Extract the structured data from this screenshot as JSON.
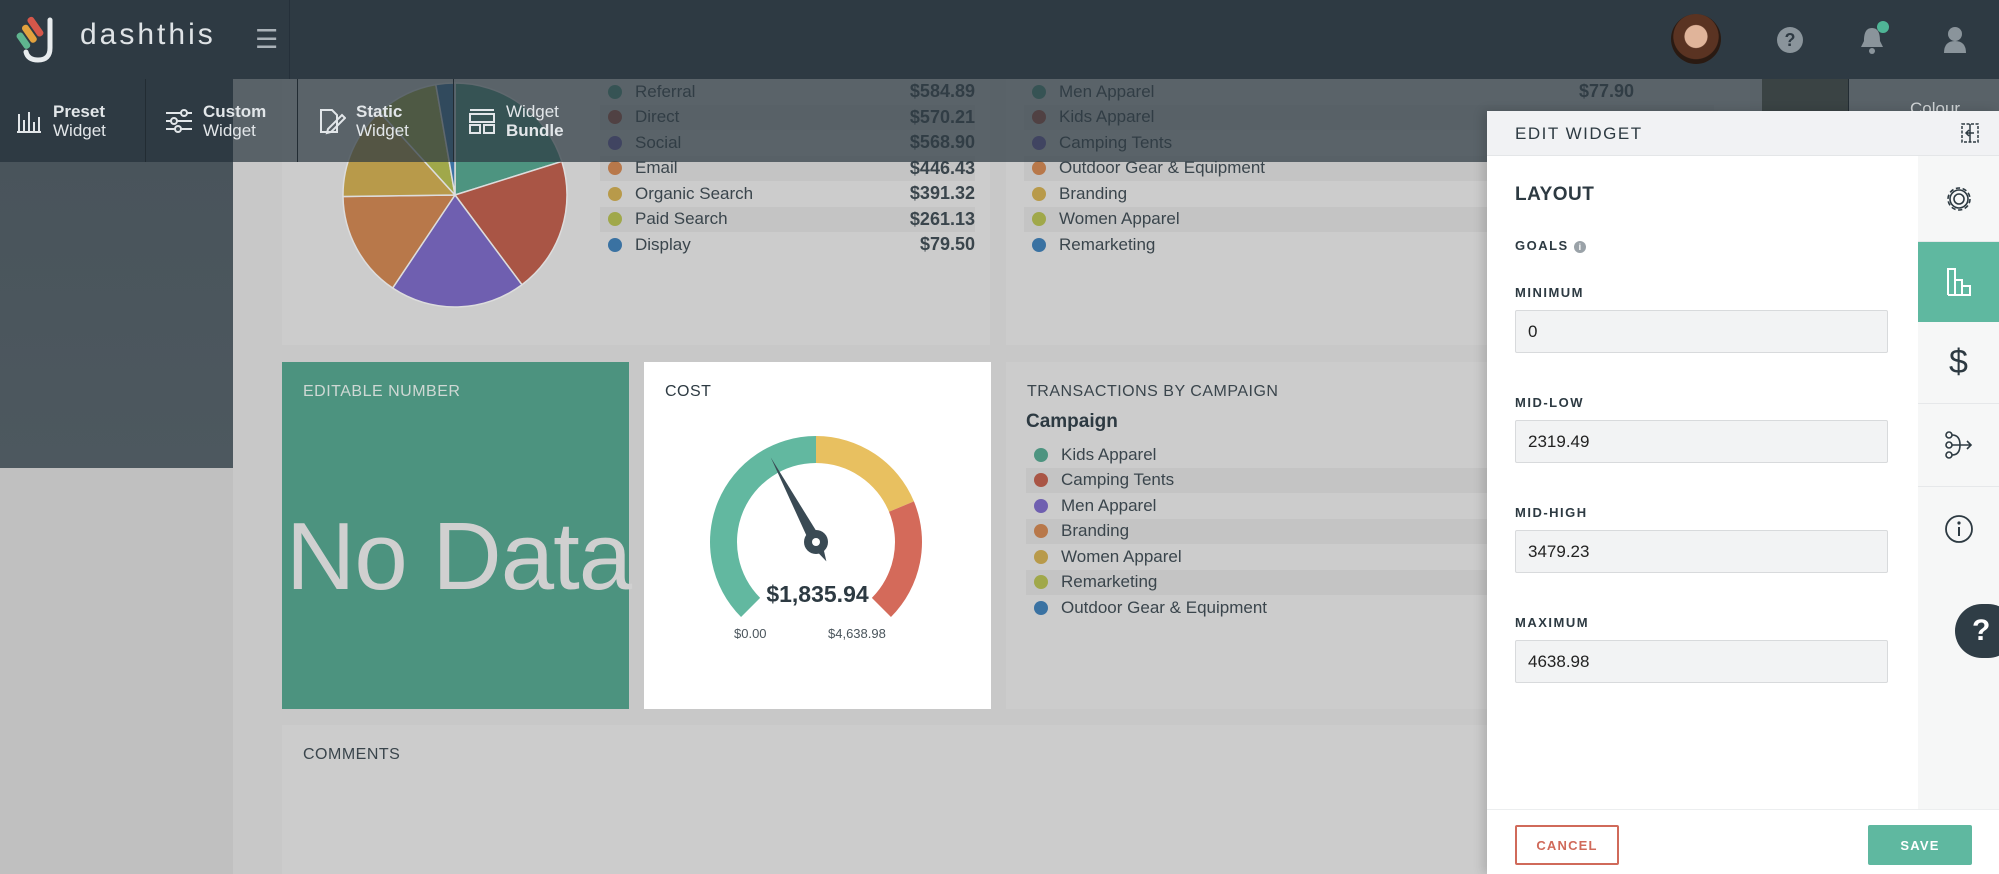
{
  "header": {
    "brand": "dashthis",
    "menu_icon": "hamburger-icon",
    "icons": [
      "avatar",
      "help-icon",
      "bell-icon",
      "user-icon"
    ]
  },
  "toolbar": {
    "items": [
      {
        "line1": "Preset",
        "line2": "Widget",
        "bold_line": 1,
        "icon": "bar-chart-icon"
      },
      {
        "line1": "Custom",
        "line2": "Widget",
        "bold_line": 1,
        "icon": "sliders-icon"
      },
      {
        "line1": "Static",
        "line2": "Widget",
        "bold_line": 1,
        "icon": "edit-doc-icon"
      },
      {
        "line1": "Widget",
        "line2": "Bundle",
        "bold_line": 2,
        "icon": "layout-icon"
      }
    ],
    "colour_label": "Colour"
  },
  "widgets": {
    "pie": {
      "legend": [
        {
          "label": "Referral",
          "value": "$584.89",
          "color": "#4d9480"
        },
        {
          "label": "Direct",
          "value": "$570.21",
          "color": "#a95545"
        },
        {
          "label": "Social",
          "value": "$568.90",
          "color": "#6f5fb0"
        },
        {
          "label": "Email",
          "value": "$446.43",
          "color": "#b8784a"
        },
        {
          "label": "Organic Search",
          "value": "$391.32",
          "color": "#b89a4a"
        },
        {
          "label": "Paid Search",
          "value": "$261.13",
          "color": "#a0a84a"
        },
        {
          "label": "Display",
          "value": "$79.50",
          "color": "#3a72a2"
        }
      ]
    },
    "campaign_top": {
      "legend": [
        {
          "label": "Men Apparel",
          "value": "$77.90",
          "color": "#4d9480"
        },
        {
          "label": "Kids Apparel",
          "value": "",
          "color": "#a95545"
        },
        {
          "label": "Camping Tents",
          "value": "",
          "color": "#6f5fb0"
        },
        {
          "label": "Outdoor Gear & Equipment",
          "value": "",
          "color": "#b8784a"
        },
        {
          "label": "Branding",
          "value": "",
          "color": "#b89a4a"
        },
        {
          "label": "Women Apparel",
          "value": "",
          "color": "#a0a84a"
        },
        {
          "label": "Remarketing",
          "value": "",
          "color": "#3a72a2"
        }
      ]
    },
    "editable": {
      "title": "EDITABLE NUMBER",
      "value": "No Data"
    },
    "cost": {
      "title": "COST",
      "value": "$1,835.94",
      "min_label": "$0.00",
      "max_label": "$4,638.98"
    },
    "transactions": {
      "title": "TRANSACTIONS BY CAMPAIGN",
      "subtitle": "Campaign",
      "legend": [
        {
          "label": "Kids Apparel",
          "color": "#4d9480"
        },
        {
          "label": "Camping Tents",
          "color": "#a95545"
        },
        {
          "label": "Men Apparel",
          "color": "#6f5fb0"
        },
        {
          "label": "Branding",
          "color": "#b8784a"
        },
        {
          "label": "Women Apparel",
          "color": "#b89a4a"
        },
        {
          "label": "Remarketing",
          "color": "#a0a84a"
        },
        {
          "label": "Outdoor Gear & Equipment",
          "color": "#3a72a2"
        }
      ]
    },
    "comments": {
      "title": "COMMENTS"
    }
  },
  "chart_data": [
    {
      "type": "pie",
      "categories": [
        "Referral",
        "Direct",
        "Social",
        "Email",
        "Organic Search",
        "Paid Search",
        "Display"
      ],
      "values": [
        584.89,
        570.21,
        568.9,
        446.43,
        391.32,
        261.13,
        79.5
      ]
    },
    {
      "type": "gauge",
      "title": "COST",
      "value": 1835.94,
      "min": 0,
      "mid_low": 2319.49,
      "mid_high": 3479.23,
      "max": 4638.98,
      "colors": {
        "low": "#62b8a0",
        "mid": "#e8c060",
        "high": "#d46a5a"
      }
    }
  ],
  "panel": {
    "title": "EDIT WIDGET",
    "section": "LAYOUT",
    "goals_label": "GOALS",
    "fields": [
      {
        "label": "MINIMUM",
        "value": "0"
      },
      {
        "label": "MID-LOW",
        "value": "2319.49"
      },
      {
        "label": "MID-HIGH",
        "value": "3479.23"
      },
      {
        "label": "MAXIMUM",
        "value": "4638.98"
      }
    ],
    "cancel": "CANCEL",
    "save": "SAVE",
    "rail": [
      "gear-icon",
      "bar-chart-icon",
      "dollar-icon",
      "branch-icon",
      "info-icon"
    ],
    "help": "?",
    "accent": "#5fb8a0",
    "cancel_color": "#d06a5a"
  }
}
